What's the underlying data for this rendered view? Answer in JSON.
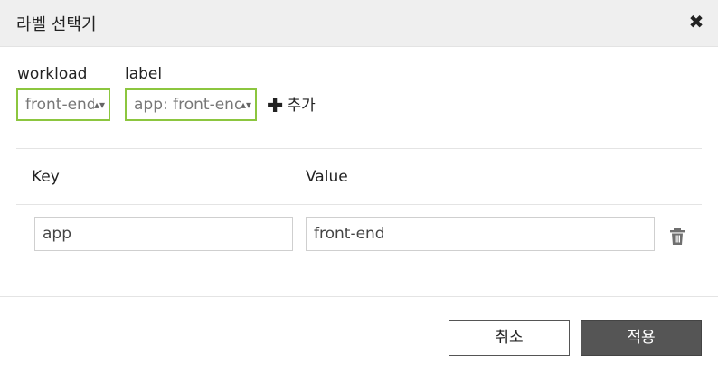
{
  "dialog": {
    "title": "라벨 선택기",
    "close_icon": "close-icon"
  },
  "filters": {
    "workload_label": "workload",
    "workload_value": "front-end",
    "label_label": "label",
    "label_value": "app: front-end",
    "add_label": "추가",
    "add_icon": "plus-icon"
  },
  "table": {
    "key_header": "Key",
    "value_header": "Value",
    "rows": [
      {
        "key": "app",
        "value": "front-end",
        "delete_icon": "trash-icon"
      }
    ]
  },
  "footer": {
    "cancel_label": "취소",
    "apply_label": "적용"
  },
  "colors": {
    "accent_border": "#8cc63f",
    "header_bg": "#efefef",
    "primary_button": "#555555"
  }
}
